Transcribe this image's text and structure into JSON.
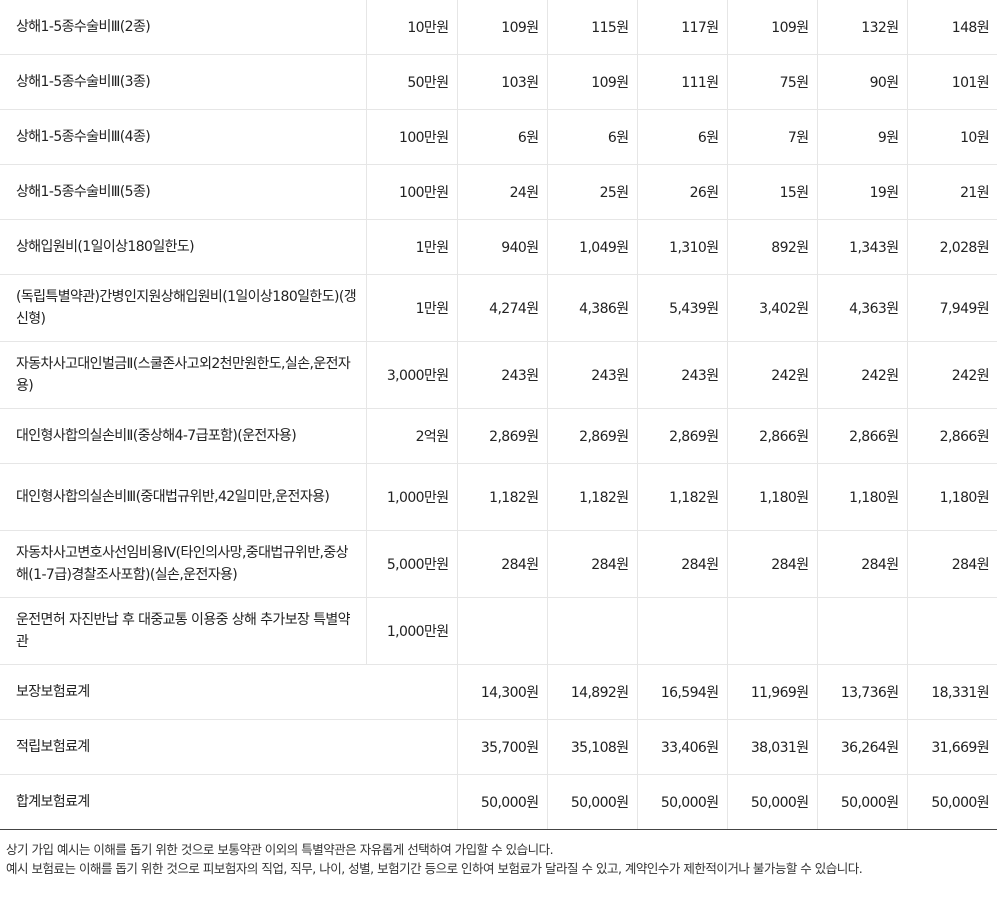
{
  "rows": [
    {
      "name": "상해1-5종수술비Ⅲ(2종)",
      "amount": "10만원",
      "values": [
        "109원",
        "115원",
        "117원",
        "109원",
        "132원",
        "148원"
      ]
    },
    {
      "name": "상해1-5종수술비Ⅲ(3종)",
      "amount": "50만원",
      "values": [
        "103원",
        "109원",
        "111원",
        "75원",
        "90원",
        "101원"
      ]
    },
    {
      "name": "상해1-5종수술비Ⅲ(4종)",
      "amount": "100만원",
      "values": [
        "6원",
        "6원",
        "6원",
        "7원",
        "9원",
        "10원"
      ]
    },
    {
      "name": "상해1-5종수술비Ⅲ(5종)",
      "amount": "100만원",
      "values": [
        "24원",
        "25원",
        "26원",
        "15원",
        "19원",
        "21원"
      ]
    },
    {
      "name": "상해입원비(1일이상180일한도)",
      "amount": "1만원",
      "values": [
        "940원",
        "1,049원",
        "1,310원",
        "892원",
        "1,343원",
        "2,028원"
      ]
    },
    {
      "name": "(독립특별약관)간병인지원상해입원비(1일이상180일한도)(갱신형)",
      "amount": "1만원",
      "values": [
        "4,274원",
        "4,386원",
        "5,439원",
        "3,402원",
        "4,363원",
        "7,949원"
      ]
    },
    {
      "name": "자동차사고대인벌금Ⅱ(스쿨존사고외2천만원한도,실손,운전자용)",
      "amount": "3,000만원",
      "values": [
        "243원",
        "243원",
        "243원",
        "242원",
        "242원",
        "242원"
      ]
    },
    {
      "name": "대인형사합의실손비Ⅱ(중상해4-7급포함)(운전자용)",
      "amount": "2억원",
      "values": [
        "2,869원",
        "2,869원",
        "2,869원",
        "2,866원",
        "2,866원",
        "2,866원"
      ]
    },
    {
      "name": "대인형사합의실손비Ⅲ(중대법규위반,42일미만,운전자용)",
      "amount": "1,000만원",
      "values": [
        "1,182원",
        "1,182원",
        "1,182원",
        "1,180원",
        "1,180원",
        "1,180원"
      ]
    },
    {
      "name": "자동차사고변호사선임비용Ⅳ(타인의사망,중대법규위반,중상해(1-7급)경찰조사포함)(실손,운전자용)",
      "amount": "5,000만원",
      "values": [
        "284원",
        "284원",
        "284원",
        "284원",
        "284원",
        "284원"
      ]
    },
    {
      "name": "운전면허 자진반납 후 대중교통 이용중 상해 추가보장 특별약관",
      "amount": "1,000만원",
      "values": [
        "",
        "",
        "",
        "",
        "",
        ""
      ]
    }
  ],
  "totals": [
    {
      "label": "보장보험료계",
      "values": [
        "14,300원",
        "14,892원",
        "16,594원",
        "11,969원",
        "13,736원",
        "18,331원"
      ]
    },
    {
      "label": "적립보험료계",
      "values": [
        "35,700원",
        "35,108원",
        "33,406원",
        "38,031원",
        "36,264원",
        "31,669원"
      ]
    },
    {
      "label": "합계보험료계",
      "values": [
        "50,000원",
        "50,000원",
        "50,000원",
        "50,000원",
        "50,000원",
        "50,000원"
      ]
    }
  ],
  "notes": [
    "상기 가입 예시는 이해를 돕기 위한 것으로 보통약관 이외의 특별약관은 자유롭게 선택하여 가입할 수 있습니다.",
    "예시 보험료는 이해를 돕기 위한 것으로 피보험자의 직업, 직무, 나이, 성별, 보험기간 등으로 인하여 보험료가 달라질 수 있고, 계약인수가 제한적이거나 불가능할 수 있습니다."
  ]
}
